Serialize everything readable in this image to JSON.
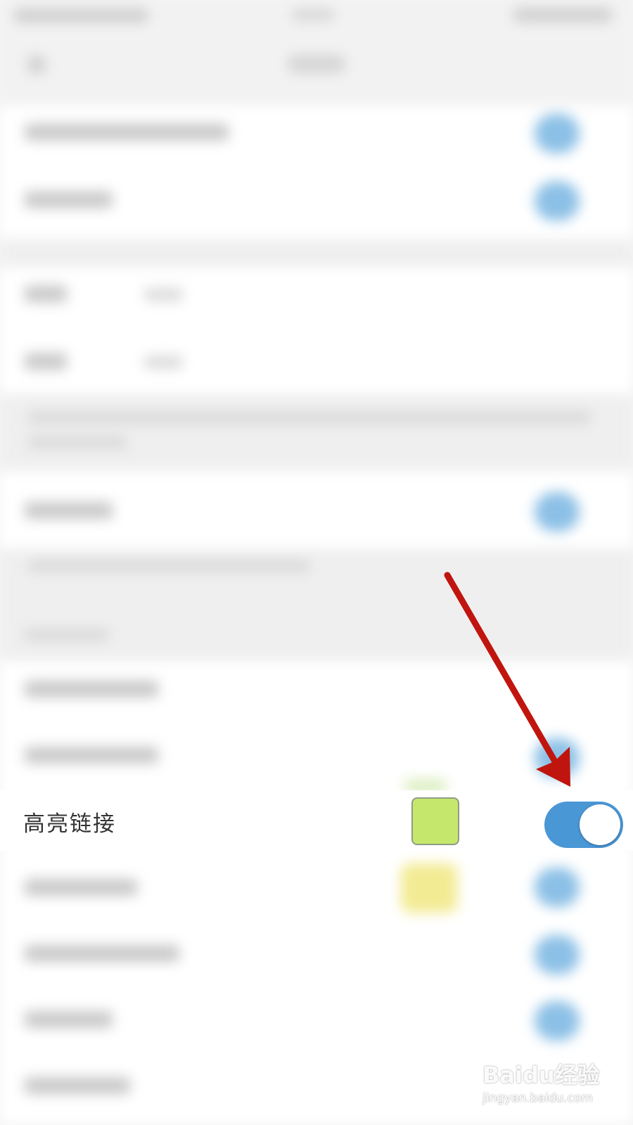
{
  "highlight_row": {
    "label": "高亮链接",
    "swatch_color": "#c5e86c",
    "toggle_on": true,
    "toggle_color": "#4a97d6"
  },
  "annotation": {
    "arrow_color": "#c0150e"
  },
  "watermark": {
    "brand": "Baidu经验",
    "url": "jingyan.baidu.com"
  }
}
